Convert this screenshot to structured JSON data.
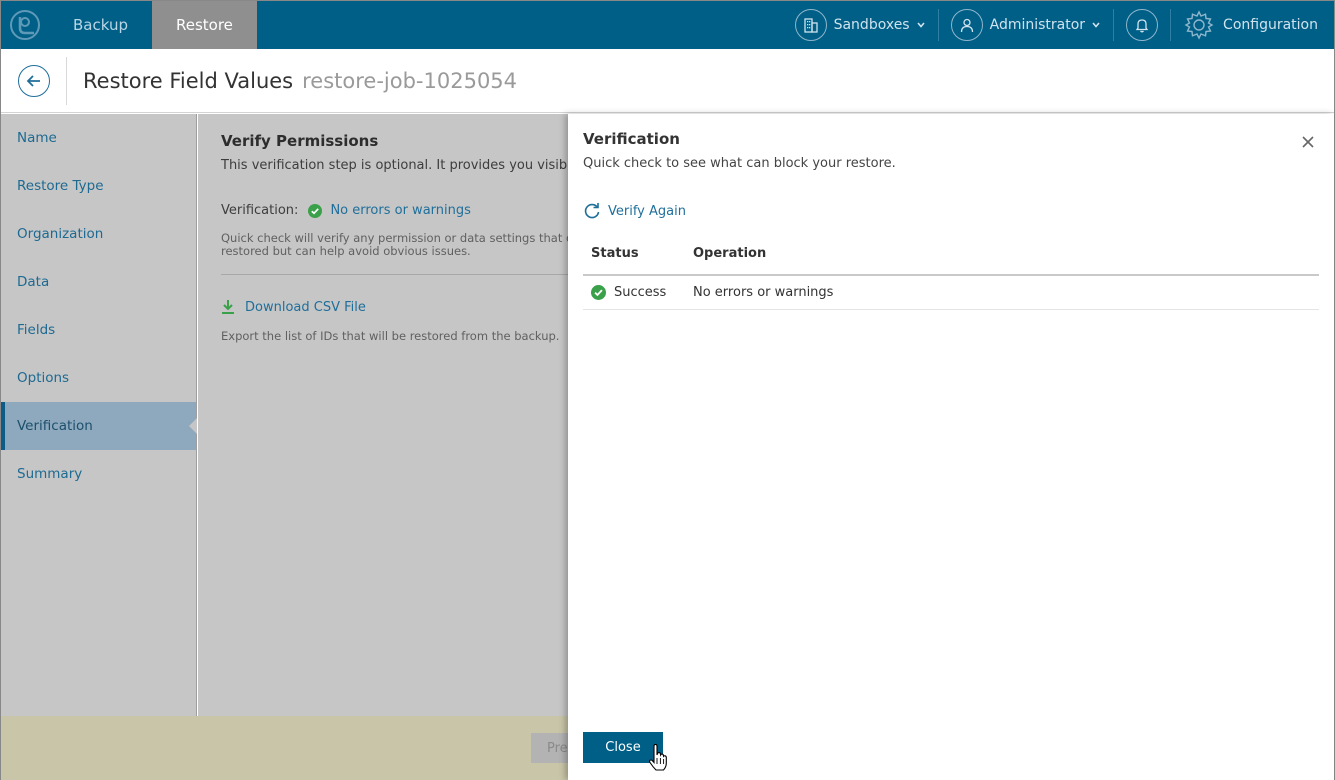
{
  "topbar": {
    "tabs": [
      {
        "label": "Backup"
      },
      {
        "label": "Restore"
      }
    ],
    "sandboxes": "Sandboxes",
    "user": "Administrator",
    "configuration": "Configuration"
  },
  "header": {
    "title": "Restore Field Values",
    "subtitle": "restore-job-1025054"
  },
  "sidebar": {
    "items": [
      {
        "label": "Name"
      },
      {
        "label": "Restore Type"
      },
      {
        "label": "Organization"
      },
      {
        "label": "Data"
      },
      {
        "label": "Fields"
      },
      {
        "label": "Options"
      },
      {
        "label": "Verification"
      },
      {
        "label": "Summary"
      }
    ],
    "active_index": 6
  },
  "main": {
    "heading": "Verify Permissions",
    "description": "This verification step is optional. It provides you visibility i",
    "verification_label": "Verification:",
    "verification_status": "No errors or warnings",
    "note_line1": "Quick check will verify any permission or data settings that car",
    "note_line2": "restored but can help avoid obvious issues.",
    "download_label": "Download CSV File",
    "export_note": "Export the list of IDs that will be restored from the backup."
  },
  "footer": {
    "prev_label": "Pre"
  },
  "panel": {
    "title": "Verification",
    "subtitle": "Quick check to see what can block your restore.",
    "verify_again": "Verify Again",
    "columns": {
      "status": "Status",
      "operation": "Operation"
    },
    "rows": [
      {
        "status": "Success",
        "operation": "No errors or warnings"
      }
    ],
    "close_label": "Close"
  },
  "colors": {
    "brand": "#005f87",
    "success": "#3aa04a",
    "link": "#1f6f9b"
  }
}
